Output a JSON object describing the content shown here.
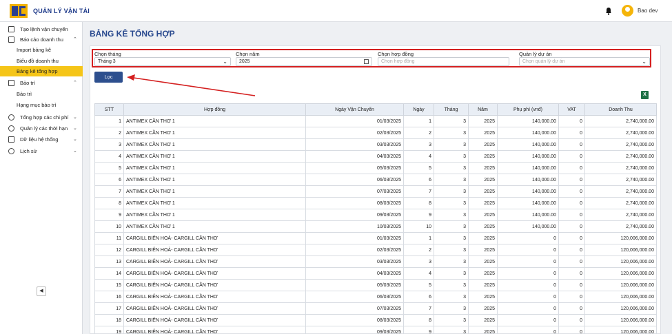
{
  "app": {
    "title": "QUẢN LÝ VẬN TẢI",
    "user": "Bao dev"
  },
  "sidebar": {
    "items": [
      {
        "label": "Tạo lệnh vận chuyển",
        "icon": "document-icon"
      },
      {
        "label": "Báo cáo doanh thu",
        "icon": "report-icon"
      },
      {
        "label": "Bảo trì",
        "icon": "wrench-icon"
      },
      {
        "label": "Tổng hợp các chi phí",
        "icon": "dollar-icon"
      },
      {
        "label": "Quản lý các thời hạn",
        "icon": "clock-icon"
      },
      {
        "label": "Dữ liệu hệ thống",
        "icon": "database-icon"
      },
      {
        "label": "Lịch sử",
        "icon": "history-icon"
      }
    ],
    "report_sub": [
      "Import bảng kê",
      "Biểu đồ doanh thu",
      "Bảng kê tổng hợp"
    ],
    "maint_sub": [
      "Bảo trì",
      "Hạng mục bảo trì"
    ],
    "collapse": "◀"
  },
  "page": {
    "title": "BẢNG KÊ TỔNG HỢP"
  },
  "filters": {
    "month": {
      "label": "Chọn tháng",
      "value": "Tháng 3"
    },
    "year": {
      "label": "Chọn năm",
      "value": "2025"
    },
    "contract": {
      "label": "Chọn hợp đồng",
      "placeholder": "Chọn hợp đồng"
    },
    "pm": {
      "label": "Quản lý dự án",
      "placeholder": "Chọn quản lý dự án"
    },
    "button": "Lọc"
  },
  "colors": {
    "accent": "#2d4f8e",
    "highlight": "#d42020",
    "active": "#f5c518"
  },
  "table": {
    "headers": [
      "STT",
      "Hợp đồng",
      "Ngày Vận Chuyển",
      "Ngày",
      "Tháng",
      "Năm",
      "Phụ phí (vnđ)",
      "VAT",
      "Doanh Thu"
    ],
    "rows": [
      [
        "1",
        "ANTIMEX CẦN THƠ 1",
        "01/03/2025",
        "1",
        "3",
        "2025",
        "140,000.00",
        "0",
        "2,740,000.00"
      ],
      [
        "2",
        "ANTIMEX CẦN THƠ 1",
        "02/03/2025",
        "2",
        "3",
        "2025",
        "140,000.00",
        "0",
        "2,740,000.00"
      ],
      [
        "3",
        "ANTIMEX CẦN THƠ 1",
        "03/03/2025",
        "3",
        "3",
        "2025",
        "140,000.00",
        "0",
        "2,740,000.00"
      ],
      [
        "4",
        "ANTIMEX CẦN THƠ 1",
        "04/03/2025",
        "4",
        "3",
        "2025",
        "140,000.00",
        "0",
        "2,740,000.00"
      ],
      [
        "5",
        "ANTIMEX CẦN THƠ 1",
        "05/03/2025",
        "5",
        "3",
        "2025",
        "140,000.00",
        "0",
        "2,740,000.00"
      ],
      [
        "6",
        "ANTIMEX CẦN THƠ 1",
        "06/03/2025",
        "6",
        "3",
        "2025",
        "140,000.00",
        "0",
        "2,740,000.00"
      ],
      [
        "7",
        "ANTIMEX CẦN THƠ 1",
        "07/03/2025",
        "7",
        "3",
        "2025",
        "140,000.00",
        "0",
        "2,740,000.00"
      ],
      [
        "8",
        "ANTIMEX CẦN THƠ 1",
        "08/03/2025",
        "8",
        "3",
        "2025",
        "140,000.00",
        "0",
        "2,740,000.00"
      ],
      [
        "9",
        "ANTIMEX CẦN THƠ 1",
        "09/03/2025",
        "9",
        "3",
        "2025",
        "140,000.00",
        "0",
        "2,740,000.00"
      ],
      [
        "10",
        "ANTIMEX CẦN THƠ 1",
        "10/03/2025",
        "10",
        "3",
        "2025",
        "140,000.00",
        "0",
        "2,740,000.00"
      ],
      [
        "11",
        "CARGILL BIÊN HOÀ- CARGILL CẦN THƠ",
        "01/03/2025",
        "1",
        "3",
        "2025",
        "0",
        "0",
        "120,006,000.00"
      ],
      [
        "12",
        "CARGILL BIÊN HOÀ- CARGILL CẦN THƠ",
        "02/03/2025",
        "2",
        "3",
        "2025",
        "0",
        "0",
        "120,006,000.00"
      ],
      [
        "13",
        "CARGILL BIÊN HOÀ- CARGILL CẦN THƠ",
        "03/03/2025",
        "3",
        "3",
        "2025",
        "0",
        "0",
        "120,006,000.00"
      ],
      [
        "14",
        "CARGILL BIÊN HOÀ- CARGILL CẦN THƠ",
        "04/03/2025",
        "4",
        "3",
        "2025",
        "0",
        "0",
        "120,006,000.00"
      ],
      [
        "15",
        "CARGILL BIÊN HOÀ- CARGILL CẦN THƠ",
        "05/03/2025",
        "5",
        "3",
        "2025",
        "0",
        "0",
        "120,006,000.00"
      ],
      [
        "16",
        "CARGILL BIÊN HOÀ- CARGILL CẦN THƠ",
        "06/03/2025",
        "6",
        "3",
        "2025",
        "0",
        "0",
        "120,006,000.00"
      ],
      [
        "17",
        "CARGILL BIÊN HOÀ- CARGILL CẦN THƠ",
        "07/03/2025",
        "7",
        "3",
        "2025",
        "0",
        "0",
        "120,006,000.00"
      ],
      [
        "18",
        "CARGILL BIÊN HOÀ- CARGILL CẦN THƠ",
        "08/03/2025",
        "8",
        "3",
        "2025",
        "0",
        "0",
        "120,006,000.00"
      ],
      [
        "19",
        "CARGILL BIÊN HOÀ- CARGILL CẦN THƠ",
        "09/03/2025",
        "9",
        "3",
        "2025",
        "0",
        "0",
        "120,006,000.00"
      ]
    ]
  }
}
